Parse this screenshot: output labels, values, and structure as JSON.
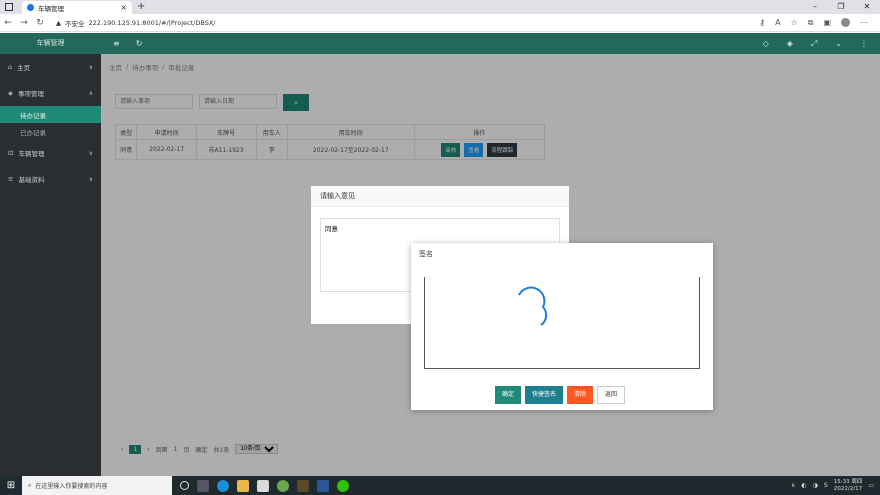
{
  "browser": {
    "tab_title": "车辆管理",
    "url_warning": "不安全",
    "url": "222.190.125.91:8001/#/|Project/DBSX/"
  },
  "app": {
    "brand": "车辆管理",
    "menu": [
      {
        "label": "主页"
      },
      {
        "label": "事项管理"
      },
      {
        "label": "车辆管理"
      },
      {
        "label": "基础资料"
      }
    ],
    "submenu": [
      {
        "label": "待办记录"
      },
      {
        "label": "已办记录"
      }
    ],
    "breadcrumb": [
      "主页",
      "/",
      "待办事项",
      "/",
      "审批记录"
    ]
  },
  "filters": {
    "placeholder1": "请输入事项",
    "placeholder2": "请输入日期"
  },
  "table": {
    "headers": [
      "类型",
      "申请时间",
      "车牌号",
      "用车人",
      "用车时间",
      "操作"
    ],
    "rows": [
      {
        "type": "同意",
        "date": "2022-02-17",
        "plate": "苏A11-1923",
        "user": "李",
        "time": "2022-02-17至2022-02-17"
      }
    ],
    "actions": [
      "审核",
      "查看",
      "流程跟踪"
    ]
  },
  "pager": {
    "current": "1",
    "goto_label": "到第",
    "page_input": "1",
    "page_suffix": "页",
    "confirm": "确定",
    "total": "共1条",
    "page_size": "10条/页"
  },
  "dialog_opinion": {
    "title": "请输入意见",
    "text": "同意"
  },
  "dialog_sign": {
    "title": "签名",
    "buttons": [
      "确定",
      "快捷签名",
      "清除",
      "返回"
    ]
  },
  "taskbar": {
    "search_placeholder": "在这里输入你要搜索的内容",
    "time": "15:33 周四",
    "date": "2022/2/17"
  },
  "colors": {
    "primary": "#1f8a77",
    "header": "#22695b",
    "sidebar": "#2a2e33",
    "orange": "#ff5722",
    "blue": "#1e9fff"
  }
}
